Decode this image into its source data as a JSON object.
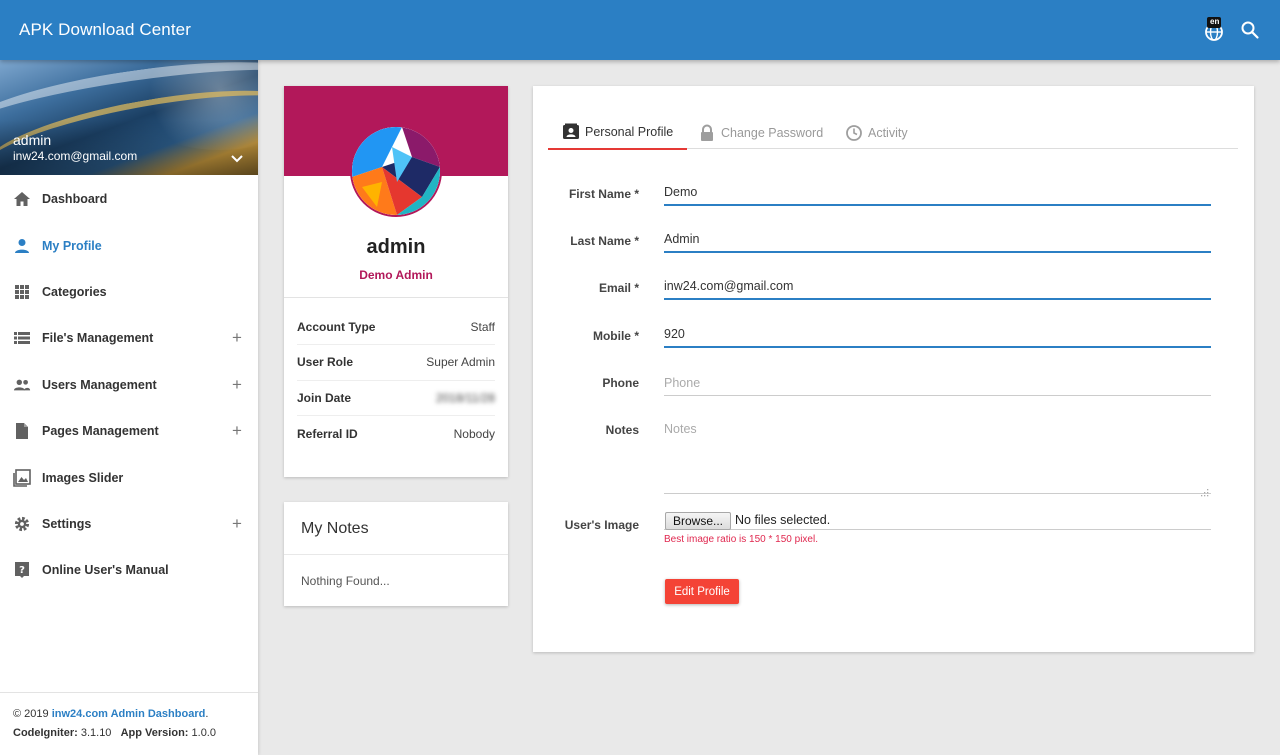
{
  "app": {
    "title": "APK Download Center",
    "lang_badge": "en",
    "primary_color": "#2b7fc4",
    "accent_color": "#b2185a",
    "danger_color": "#f44336"
  },
  "topbar_icons": [
    "language-globe-icon",
    "search-icon"
  ],
  "user": {
    "name": "admin",
    "email": "inw24.com@gmail.com"
  },
  "sidebar": {
    "items": [
      {
        "label": "Dashboard",
        "icon": "home-icon",
        "active": false,
        "expandable": false
      },
      {
        "label": "My Profile",
        "icon": "person-icon",
        "active": true,
        "expandable": false
      },
      {
        "label": "Categories",
        "icon": "grid-icon",
        "active": false,
        "expandable": false
      },
      {
        "label": "File's Management",
        "icon": "list-icon",
        "active": false,
        "expandable": true
      },
      {
        "label": "Users Management",
        "icon": "people-icon",
        "active": false,
        "expandable": true
      },
      {
        "label": "Pages Management",
        "icon": "document-icon",
        "active": false,
        "expandable": true
      },
      {
        "label": "Images Slider",
        "icon": "image-icon",
        "active": false,
        "expandable": false
      },
      {
        "label": "Settings",
        "icon": "gear-icon",
        "active": false,
        "expandable": true
      },
      {
        "label": "Online User's Manual",
        "icon": "help-icon",
        "active": false,
        "expandable": false
      }
    ],
    "plus": "+"
  },
  "footer": {
    "copyright": "© 2019",
    "link_text": "inw24.com Admin Dashboard",
    "period": ".",
    "ci_label": "CodeIgniter:",
    "ci_version": "3.1.10",
    "app_label": "App Version:",
    "app_version": "1.0.0"
  },
  "profile": {
    "name": "admin",
    "role": "Demo Admin",
    "info": [
      {
        "key": "Account Type",
        "value": "Staff"
      },
      {
        "key": "User Role",
        "value": "Super Admin"
      },
      {
        "key": "Join Date",
        "value": "2018/11/28"
      },
      {
        "key": "Referral ID",
        "value": "Nobody"
      }
    ]
  },
  "notes": {
    "title": "My Notes",
    "empty": "Nothing Found..."
  },
  "tabs": [
    {
      "label": "Personal Profile",
      "icon": "contact-card-icon",
      "active": true
    },
    {
      "label": "Change Password",
      "icon": "lock-icon",
      "active": false
    },
    {
      "label": "Activity",
      "icon": "clock-icon",
      "active": false
    }
  ],
  "form": {
    "first_name": {
      "label": "First Name *",
      "value": "Demo",
      "placeholder": ""
    },
    "last_name": {
      "label": "Last Name *",
      "value": "Admin",
      "placeholder": ""
    },
    "email": {
      "label": "Email *",
      "value": "inw24.com@gmail.com",
      "placeholder": ""
    },
    "mobile": {
      "label": "Mobile *",
      "value": "920",
      "placeholder": ""
    },
    "phone": {
      "label": "Phone",
      "value": "",
      "placeholder": "Phone"
    },
    "notes": {
      "label": "Notes",
      "value": "",
      "placeholder": "Notes"
    },
    "image": {
      "label": "User's Image",
      "browse": "Browse...",
      "status": "No files selected.",
      "hint": "Best image ratio is 150 * 150 pixel."
    },
    "submit": "Edit Profile"
  }
}
